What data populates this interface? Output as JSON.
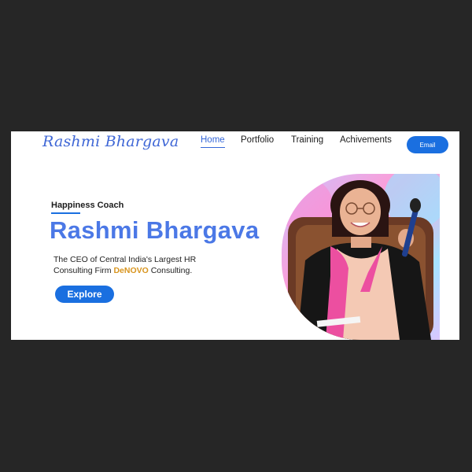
{
  "header": {
    "logo": "Rashmi Bhargava",
    "nav": [
      "Home",
      "Portfolio",
      "Training",
      "Achivements"
    ],
    "email_label": "Email"
  },
  "hero": {
    "eyebrow": "Happiness Coach",
    "title": "Rashmi Bhargava",
    "desc_before": "The CEO of Central India's Largest HR Consulting Firm ",
    "desc_brand": "DeNOVO",
    "desc_after": " Consulting.",
    "cta_label": "Explore"
  },
  "colors": {
    "background": "#262626",
    "accent": "#1a6fe0",
    "title": "#4b78e6",
    "brand": "#d8951f"
  }
}
